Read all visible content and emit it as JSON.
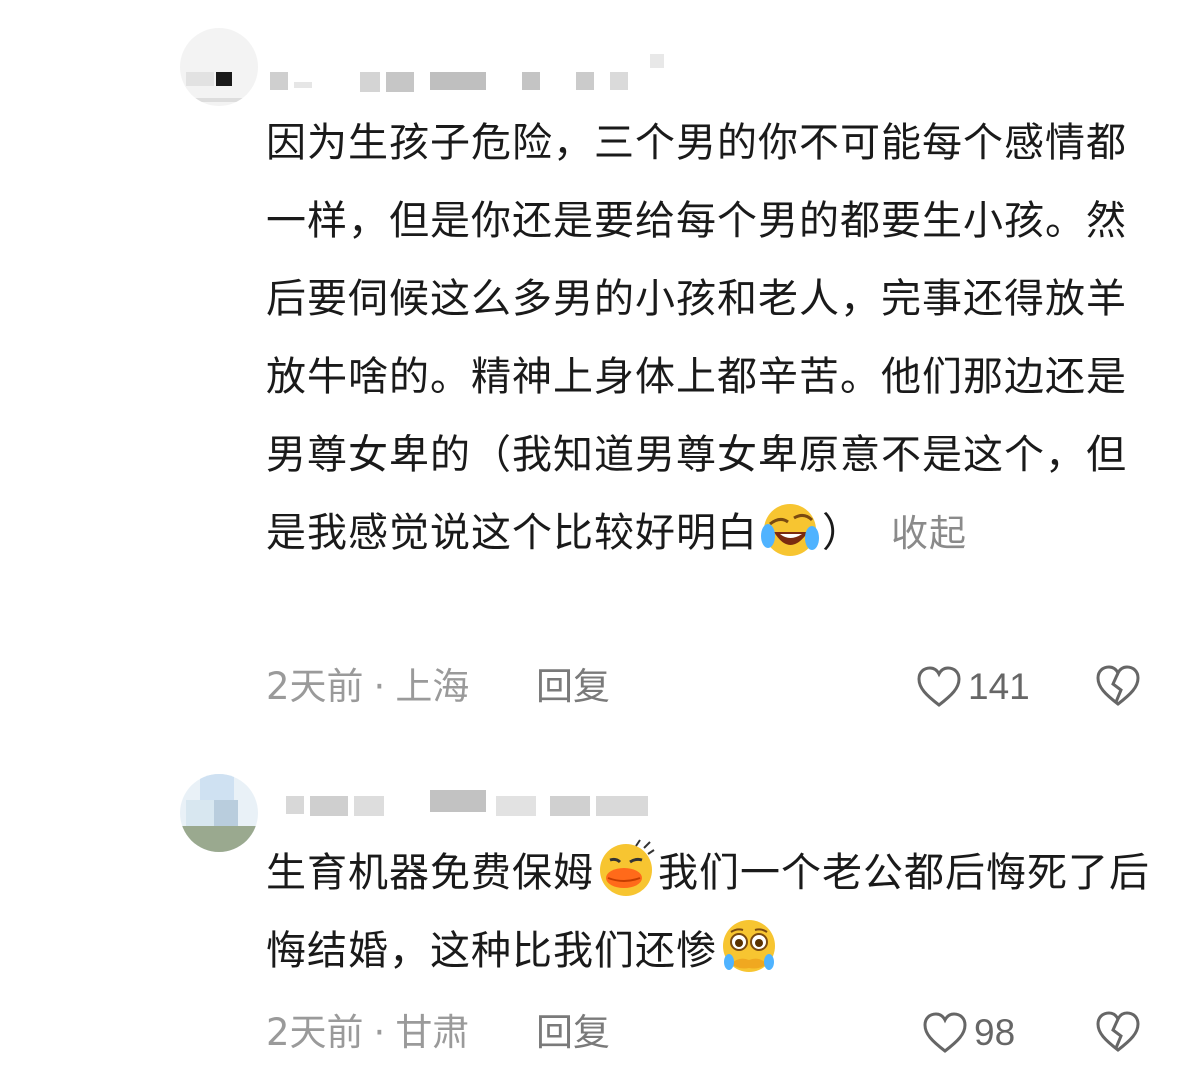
{
  "comments": [
    {
      "text_before_emoji": "因为生孩子危险，三个男的你不可能每个感情都一样，但是你还是要给每个男的都要生小孩。然后要伺候这么多男的小孩和老人，完事还得放羊放牛啥的。精神上身体上都辛苦。他们那边还是男尊女卑的（我知道男尊女卑原意不是这个，但是我感觉说这个比较好明白",
      "emoji1": "laughing-crying-face",
      "text_after_emoji": "）",
      "collapse_label": "收起",
      "time": "2天前",
      "separator": "·",
      "location": "上海",
      "reply_label": "回复",
      "like_count": "141"
    },
    {
      "text_part1": "生育机器免费保姆",
      "emoji1": "duck-lips-face",
      "text_part2": "我们一个老公都后悔死了后悔结婚，这种比我们还惨",
      "emoji2": "pleading-face",
      "time": "2天前",
      "separator": "·",
      "location": "甘肃",
      "reply_label": "回复",
      "like_count": "98"
    }
  ],
  "colors": {
    "text": "#1a1a1a",
    "meta": "#9a9a9a",
    "icon": "#666666",
    "emoji_yellow": "#f7c531"
  }
}
